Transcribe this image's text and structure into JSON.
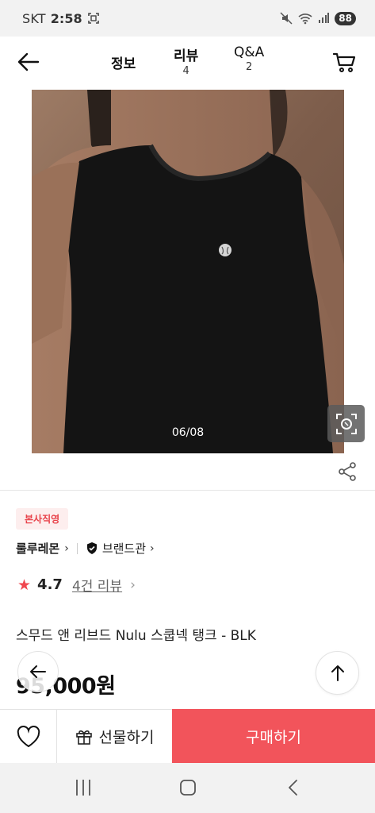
{
  "status_bar": {
    "carrier": "SKT",
    "time": "2:58",
    "battery": "88"
  },
  "header": {
    "tabs": [
      {
        "label": "정보",
        "count": ""
      },
      {
        "label": "리뷰",
        "count": "4"
      },
      {
        "label": "Q&A",
        "count": "2"
      }
    ],
    "icons": {
      "back": "arrow-left-icon",
      "cart": "cart-icon"
    }
  },
  "gallery": {
    "counter": "06/08",
    "lens_icon": "visual-search-icon",
    "share_icon": "share-icon"
  },
  "product": {
    "badge": "본사직영",
    "brand": "룰루레몬",
    "brand_hall": "브랜드관",
    "rating": "4.7",
    "review_link": "4건 리뷰",
    "title": "스무드 앤 리브드 Nulu 스쿱넥 탱크 - BLK",
    "price": "95,000원"
  },
  "actions": {
    "gift": "선물하기",
    "buy": "구매하기",
    "buy_color": "#f2545b"
  }
}
